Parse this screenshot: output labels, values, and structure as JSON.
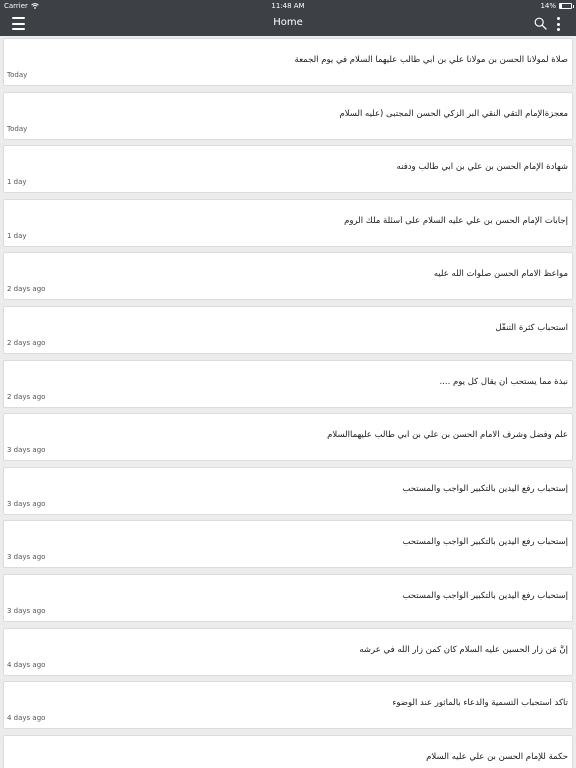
{
  "status_bar": {
    "carrier": "Carrier",
    "time": "11:48 AM",
    "battery": "14%",
    "battery_level": 0.14
  },
  "nav": {
    "title": "Home",
    "menu_icon": "hamburger-menu-icon",
    "search_icon": "search-icon",
    "more_icon": "more-vertical-icon"
  },
  "colors": {
    "bar_background": "#3d4146",
    "list_background": "#ececec",
    "card_background": "#ffffff"
  },
  "items": [
    {
      "title": "صلاة لمولانا الحسن بن مولانا علي بن ابي طالب عليهما السلام في يوم الجمعة",
      "time": "Today"
    },
    {
      "title": "معجزةالإمام التقي النقي البر الزكي الحسن المجتبى (عليه السلام",
      "time": "Today"
    },
    {
      "title": "شهادة الإمام الحسن بن علي بن ابي طالب ودفنه",
      "time": "1 day"
    },
    {
      "title": "إجابات الإمام الحسن بن علي عليه السلام على أسئلة ملك الروم",
      "time": "1 day"
    },
    {
      "title": "مواعظ الامام الحسن صلوات الله عليه",
      "time": "2 days ago"
    },
    {
      "title": "استحباب كثرة التنفّل",
      "time": "2 days ago"
    },
    {
      "title": "نبذة مما يستحب أن يقال كل يوم ....",
      "time": "2 days ago"
    },
    {
      "title": "علم وفضل وشرف الامام الحسن بن علي بن ابي طالب عليهماالسلام",
      "time": "3 days ago"
    },
    {
      "title": "إستحباب رفع اليدين بالتكبير الواجب والمستحب",
      "time": "3 days ago"
    },
    {
      "title": "إستحباب رفع اليدين بالتكبير الواجب والمستحب",
      "time": "3 days ago"
    },
    {
      "title": "إستحباب رفع اليدين بالتكبير الواجب والمستحب",
      "time": "3 days ago"
    },
    {
      "title": "إنَّ مَن زار الحسين عليه السلام كان كمن زار الله في عرشه",
      "time": "4 days ago"
    },
    {
      "title": "تاكد استحباب التسمية والدعاء بالمأثور عند الوضوء",
      "time": "4 days ago"
    },
    {
      "title": "حكمة للإمام الحسن بن علي عليه السلام",
      "time": ""
    }
  ]
}
